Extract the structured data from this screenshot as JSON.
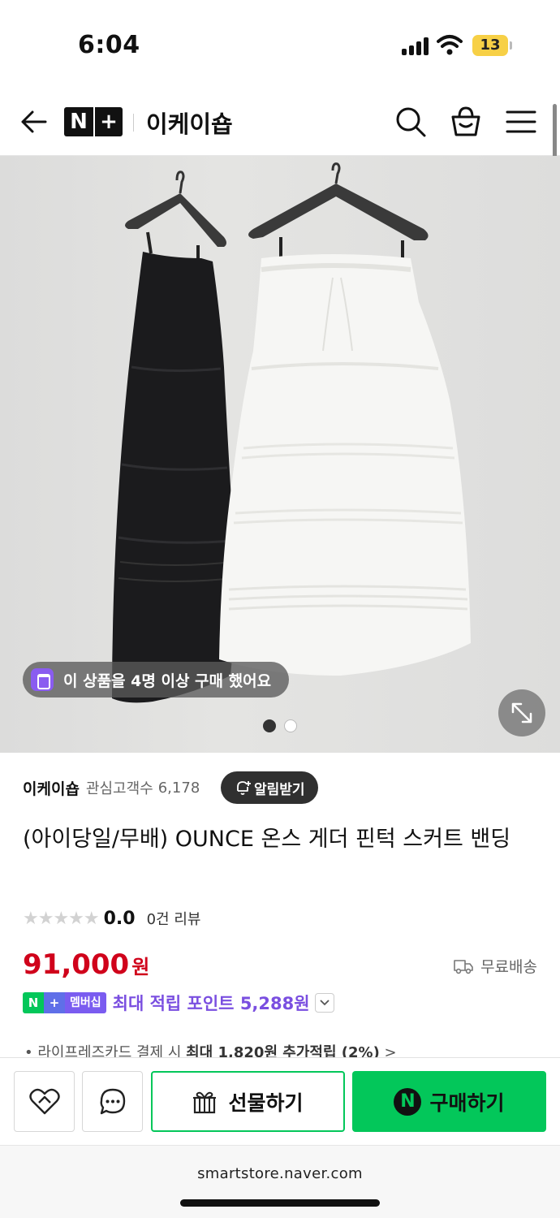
{
  "status_bar": {
    "time": "6:04",
    "battery": "13",
    "icons": [
      "signal-icon",
      "wifi-icon",
      "battery-icon"
    ]
  },
  "header": {
    "logo": {
      "n": "N",
      "plus": "+"
    },
    "store_name": "이케이숍",
    "icons": [
      "back-arrow-icon",
      "search-icon",
      "shopping-bag-icon",
      "menu-icon"
    ]
  },
  "product_image": {
    "purchase_badge": "이 상품을 4명 이상 구매 했어요",
    "slide_count": 2,
    "active_slide": 1,
    "icons": [
      "badge-bag-icon",
      "expand-icon"
    ]
  },
  "store": {
    "name": "이케이숍",
    "fans_label": "관심고객수",
    "fans": "6,178",
    "alert_button": "알림받기"
  },
  "product": {
    "title": "(아이당일/무배) OUNCE 온스 게더 핀턱 스커트 밴딩",
    "rating": "0.0",
    "rating_fraction": 0,
    "stars": "★★★★★",
    "review_count": "0건 리뷰",
    "price": "91,000",
    "price_unit": "원",
    "shipping": "무료배송"
  },
  "points": {
    "badge_n": "N",
    "badge_plus": "+",
    "badge_text": "멤버십",
    "text": "최대 적립 포인트 5,288원"
  },
  "card_benefit": {
    "prefix": "라이프레즈카드 결제 시",
    "highlight": "최대 1,820원 추가적립 (2%)",
    "suffix": ">"
  },
  "actions": {
    "gift_label": "선물하기",
    "buy_label": "구매하기",
    "buy_icon_letter": "N"
  },
  "url": "smartstore.naver.com",
  "colors": {
    "price": "#d0021b",
    "naver_green": "#03c75a",
    "points_purple": "#7a4fe0",
    "badge_purple": "#8a5cf0"
  }
}
